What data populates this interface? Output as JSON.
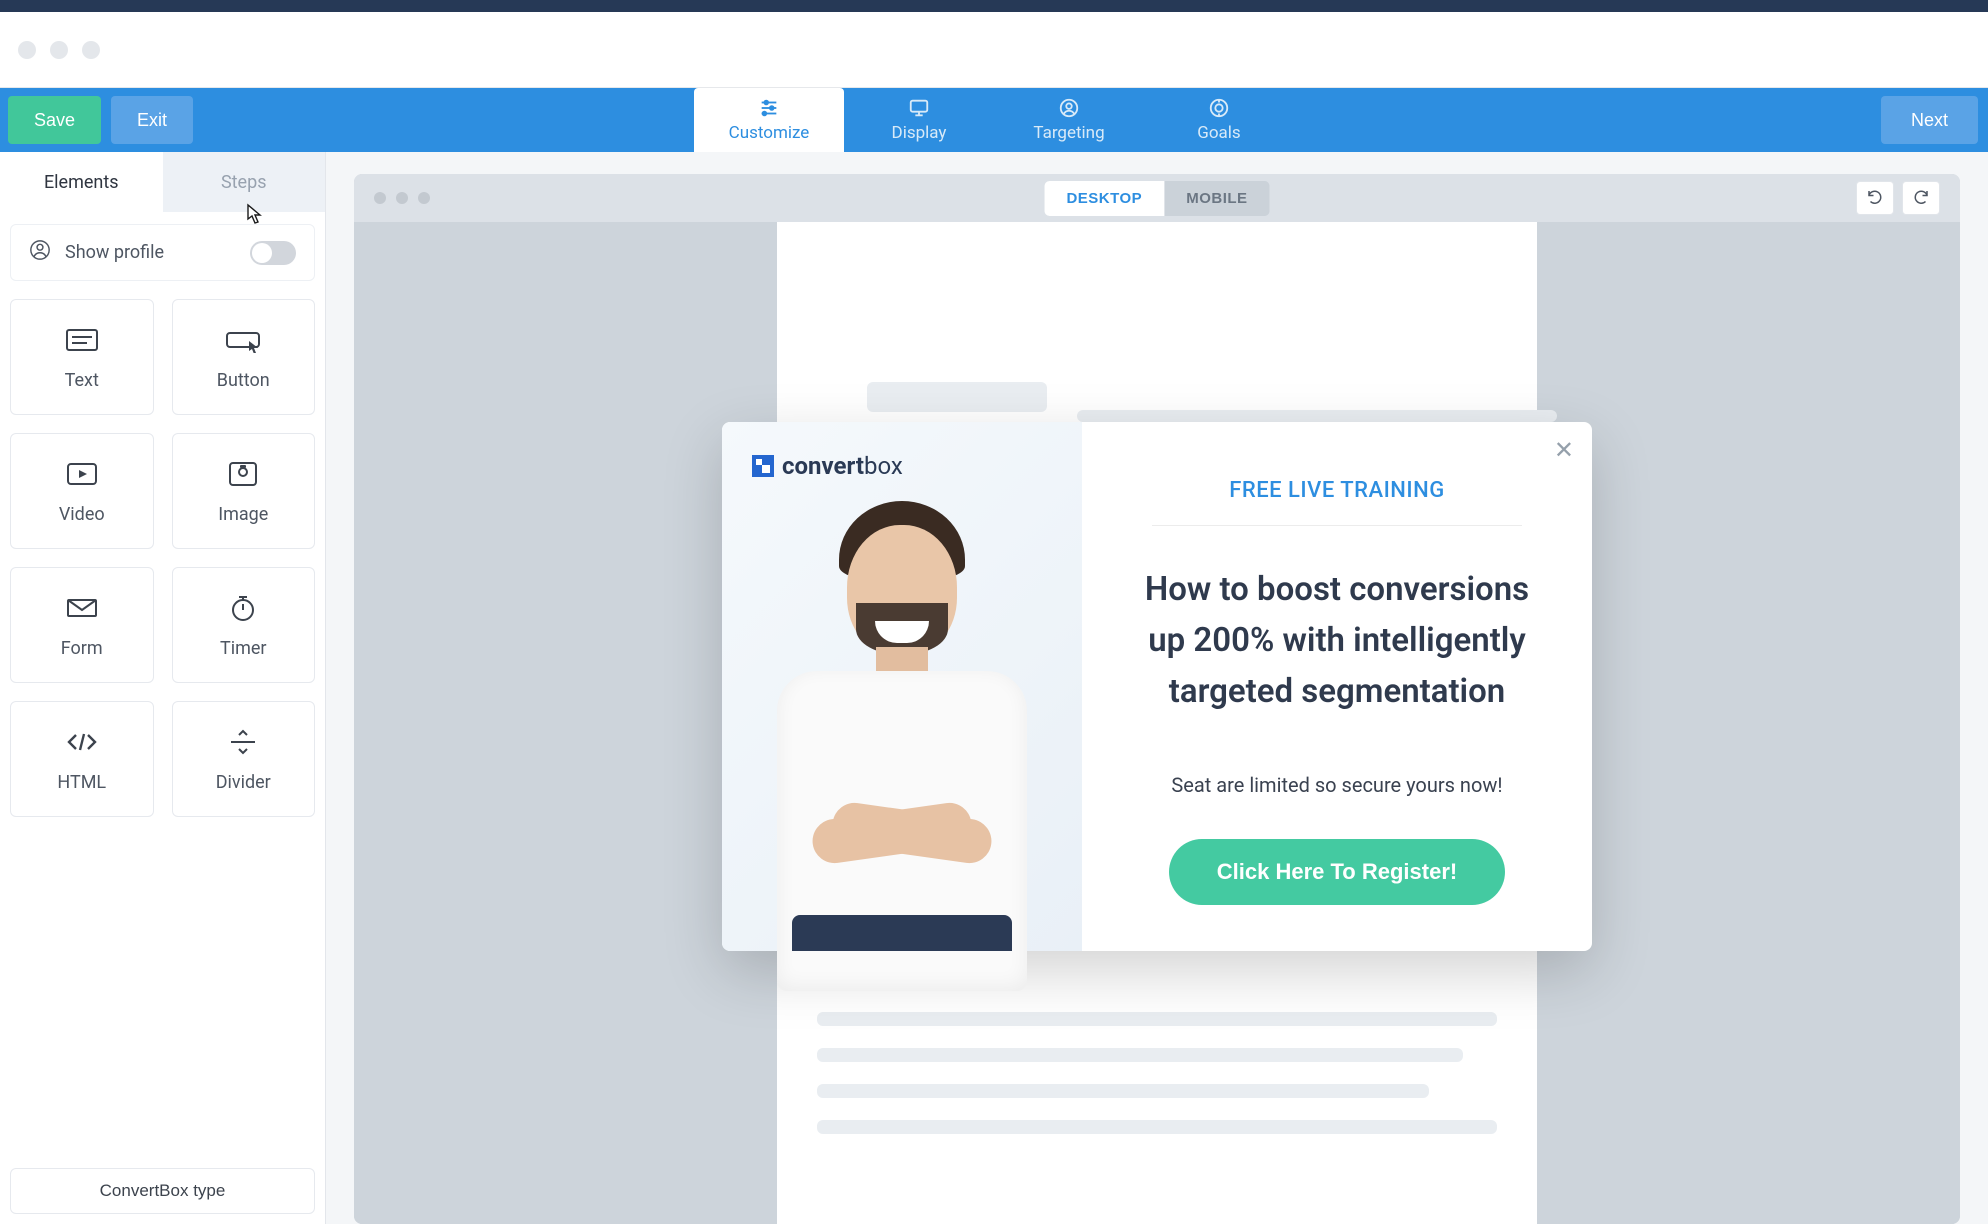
{
  "topbar": {
    "save_label": "Save",
    "exit_label": "Exit",
    "next_label": "Next",
    "tabs": [
      {
        "label": "Customize"
      },
      {
        "label": "Display"
      },
      {
        "label": "Targeting"
      },
      {
        "label": "Goals"
      }
    ],
    "active_tab": "Customize"
  },
  "sidebar": {
    "tabs": {
      "elements": "Elements",
      "steps": "Steps",
      "active": "Elements"
    },
    "show_profile_label": "Show profile",
    "show_profile_on": false,
    "elements": [
      {
        "label": "Text"
      },
      {
        "label": "Button"
      },
      {
        "label": "Video"
      },
      {
        "label": "Image"
      },
      {
        "label": "Form"
      },
      {
        "label": "Timer"
      },
      {
        "label": "HTML"
      },
      {
        "label": "Divider"
      }
    ],
    "footer_button": "ConvertBox type"
  },
  "canvas": {
    "device": {
      "desktop": "DESKTOP",
      "mobile": "MOBILE",
      "active": "DESKTOP"
    }
  },
  "popup": {
    "logo_bold": "convert",
    "logo_light": "box",
    "eyebrow": "FREE LIVE TRAINING",
    "title": "How to boost conversions up 200% with intelligently targeted segmentation",
    "subtitle": "Seat are limited so secure yours now!",
    "cta_label": "Click Here To Register!"
  },
  "colors": {
    "primary": "#2d8ee0",
    "success": "#41c79a",
    "cta": "#44caa1"
  }
}
